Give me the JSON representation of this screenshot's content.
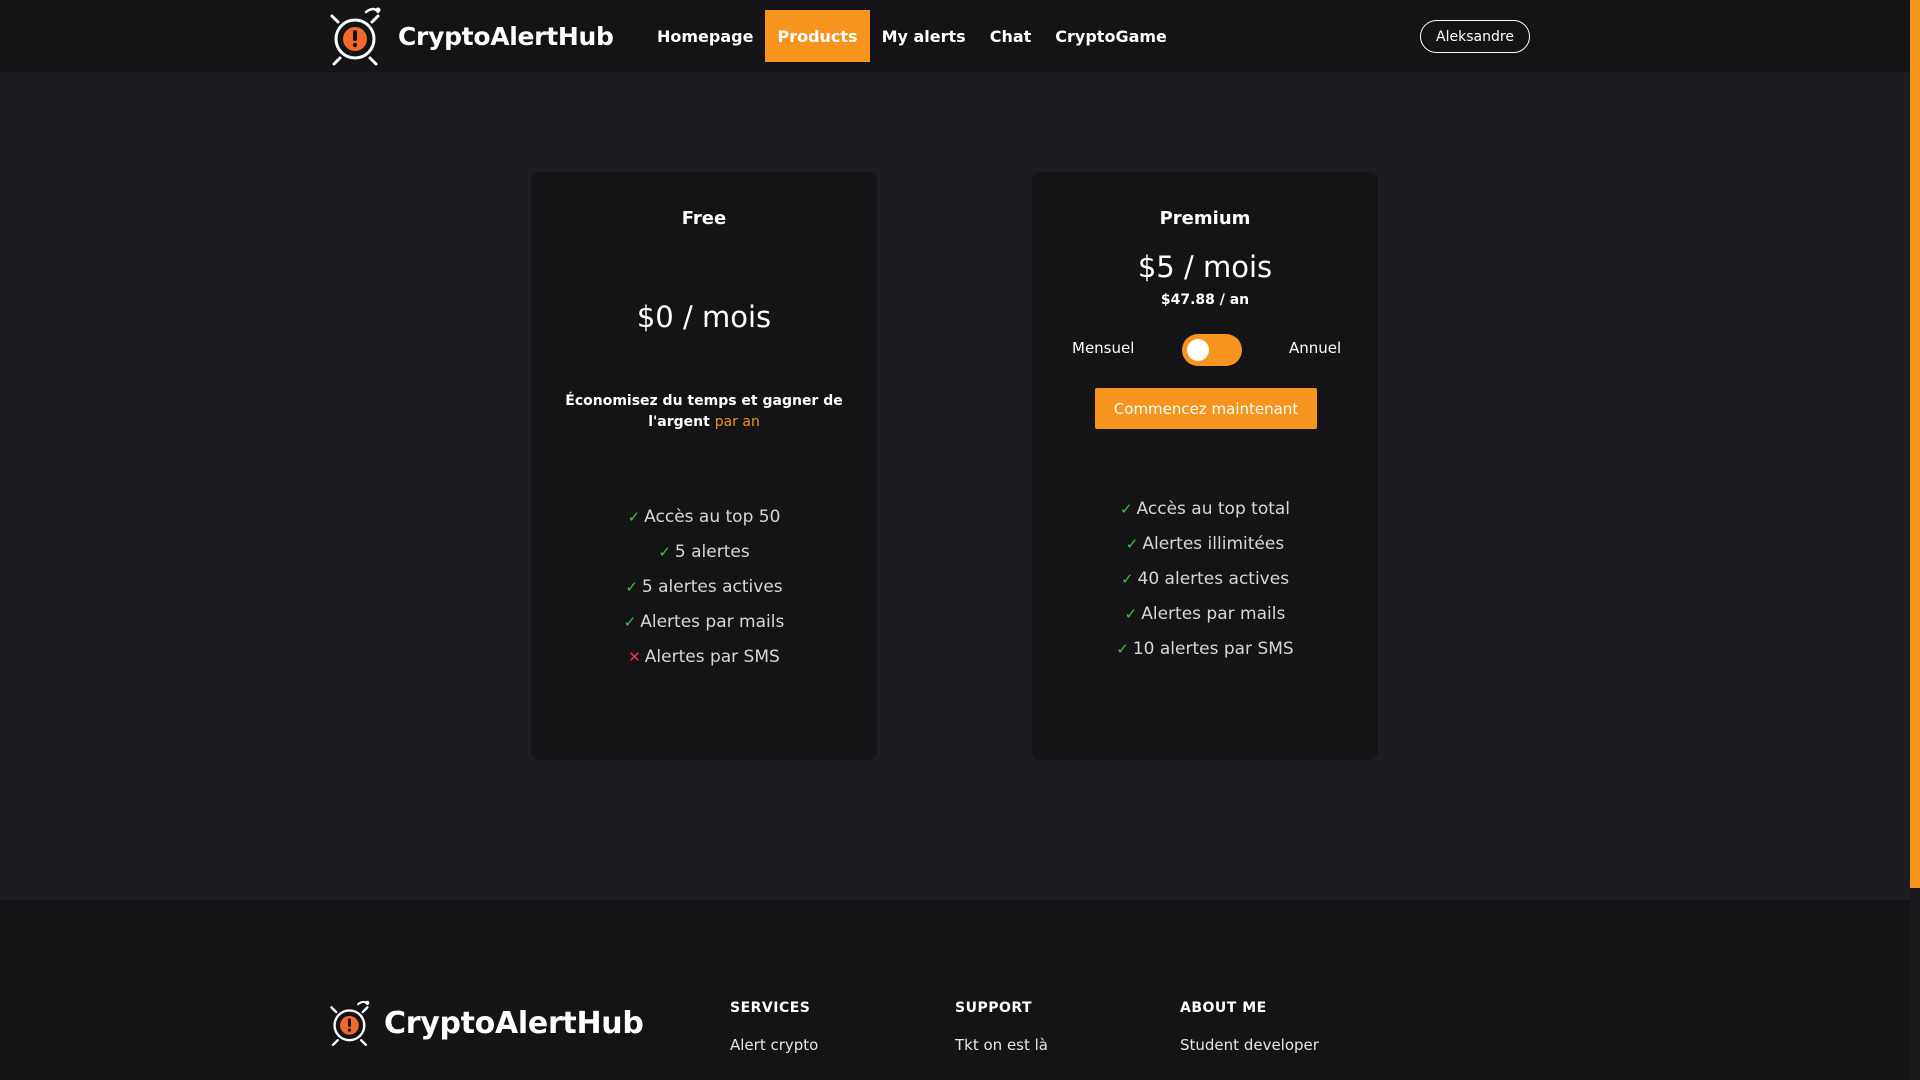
{
  "header": {
    "brand": "CryptoAlertHub",
    "nav": [
      {
        "label": "Homepage"
      },
      {
        "label": "Products",
        "active": true
      },
      {
        "label": "My alerts"
      },
      {
        "label": "Chat"
      },
      {
        "label": "CryptoGame"
      }
    ],
    "user": "Aleksandre"
  },
  "colors": {
    "accent": "#f7941d",
    "background": "#1c1d21",
    "card": "#141416",
    "check": "#3fbf4a",
    "cross": "#e8343c"
  },
  "plans": {
    "free": {
      "name": "Free",
      "price": "$0 / mois",
      "tagline_main": "Économisez du temps et gagner de l'argent",
      "tagline_accent": "par an",
      "features": [
        {
          "label": "Accès au top 50",
          "included": true
        },
        {
          "label": "5 alertes",
          "included": true
        },
        {
          "label": "5 alertes actives",
          "included": true
        },
        {
          "label": "Alertes par mails",
          "included": true
        },
        {
          "label": "Alertes par SMS",
          "included": false
        }
      ]
    },
    "premium": {
      "name": "Premium",
      "price": "$5 / mois",
      "price_annual": "$47.88 / an",
      "toggle_left": "Mensuel",
      "toggle_right": "Annuel",
      "toggle_state": "Mensuel",
      "cta": "Commencez maintenant",
      "features": [
        {
          "label": "Accès au top total",
          "included": true
        },
        {
          "label": "Alertes illimitées",
          "included": true
        },
        {
          "label": "40 alertes actives",
          "included": true
        },
        {
          "label": "Alertes par mails",
          "included": true
        },
        {
          "label": "10 alertes par SMS",
          "included": true
        }
      ]
    }
  },
  "icons": {
    "check": "✓",
    "cross": "✕"
  },
  "footer": {
    "brand": "CryptoAlertHub",
    "columns": [
      {
        "heading": "SERVICES",
        "links": [
          "Alert crypto"
        ]
      },
      {
        "heading": "SUPPORT",
        "links": [
          "Tkt on est là"
        ]
      },
      {
        "heading": "ABOUT ME",
        "links": [
          "Student developer"
        ]
      }
    ]
  }
}
